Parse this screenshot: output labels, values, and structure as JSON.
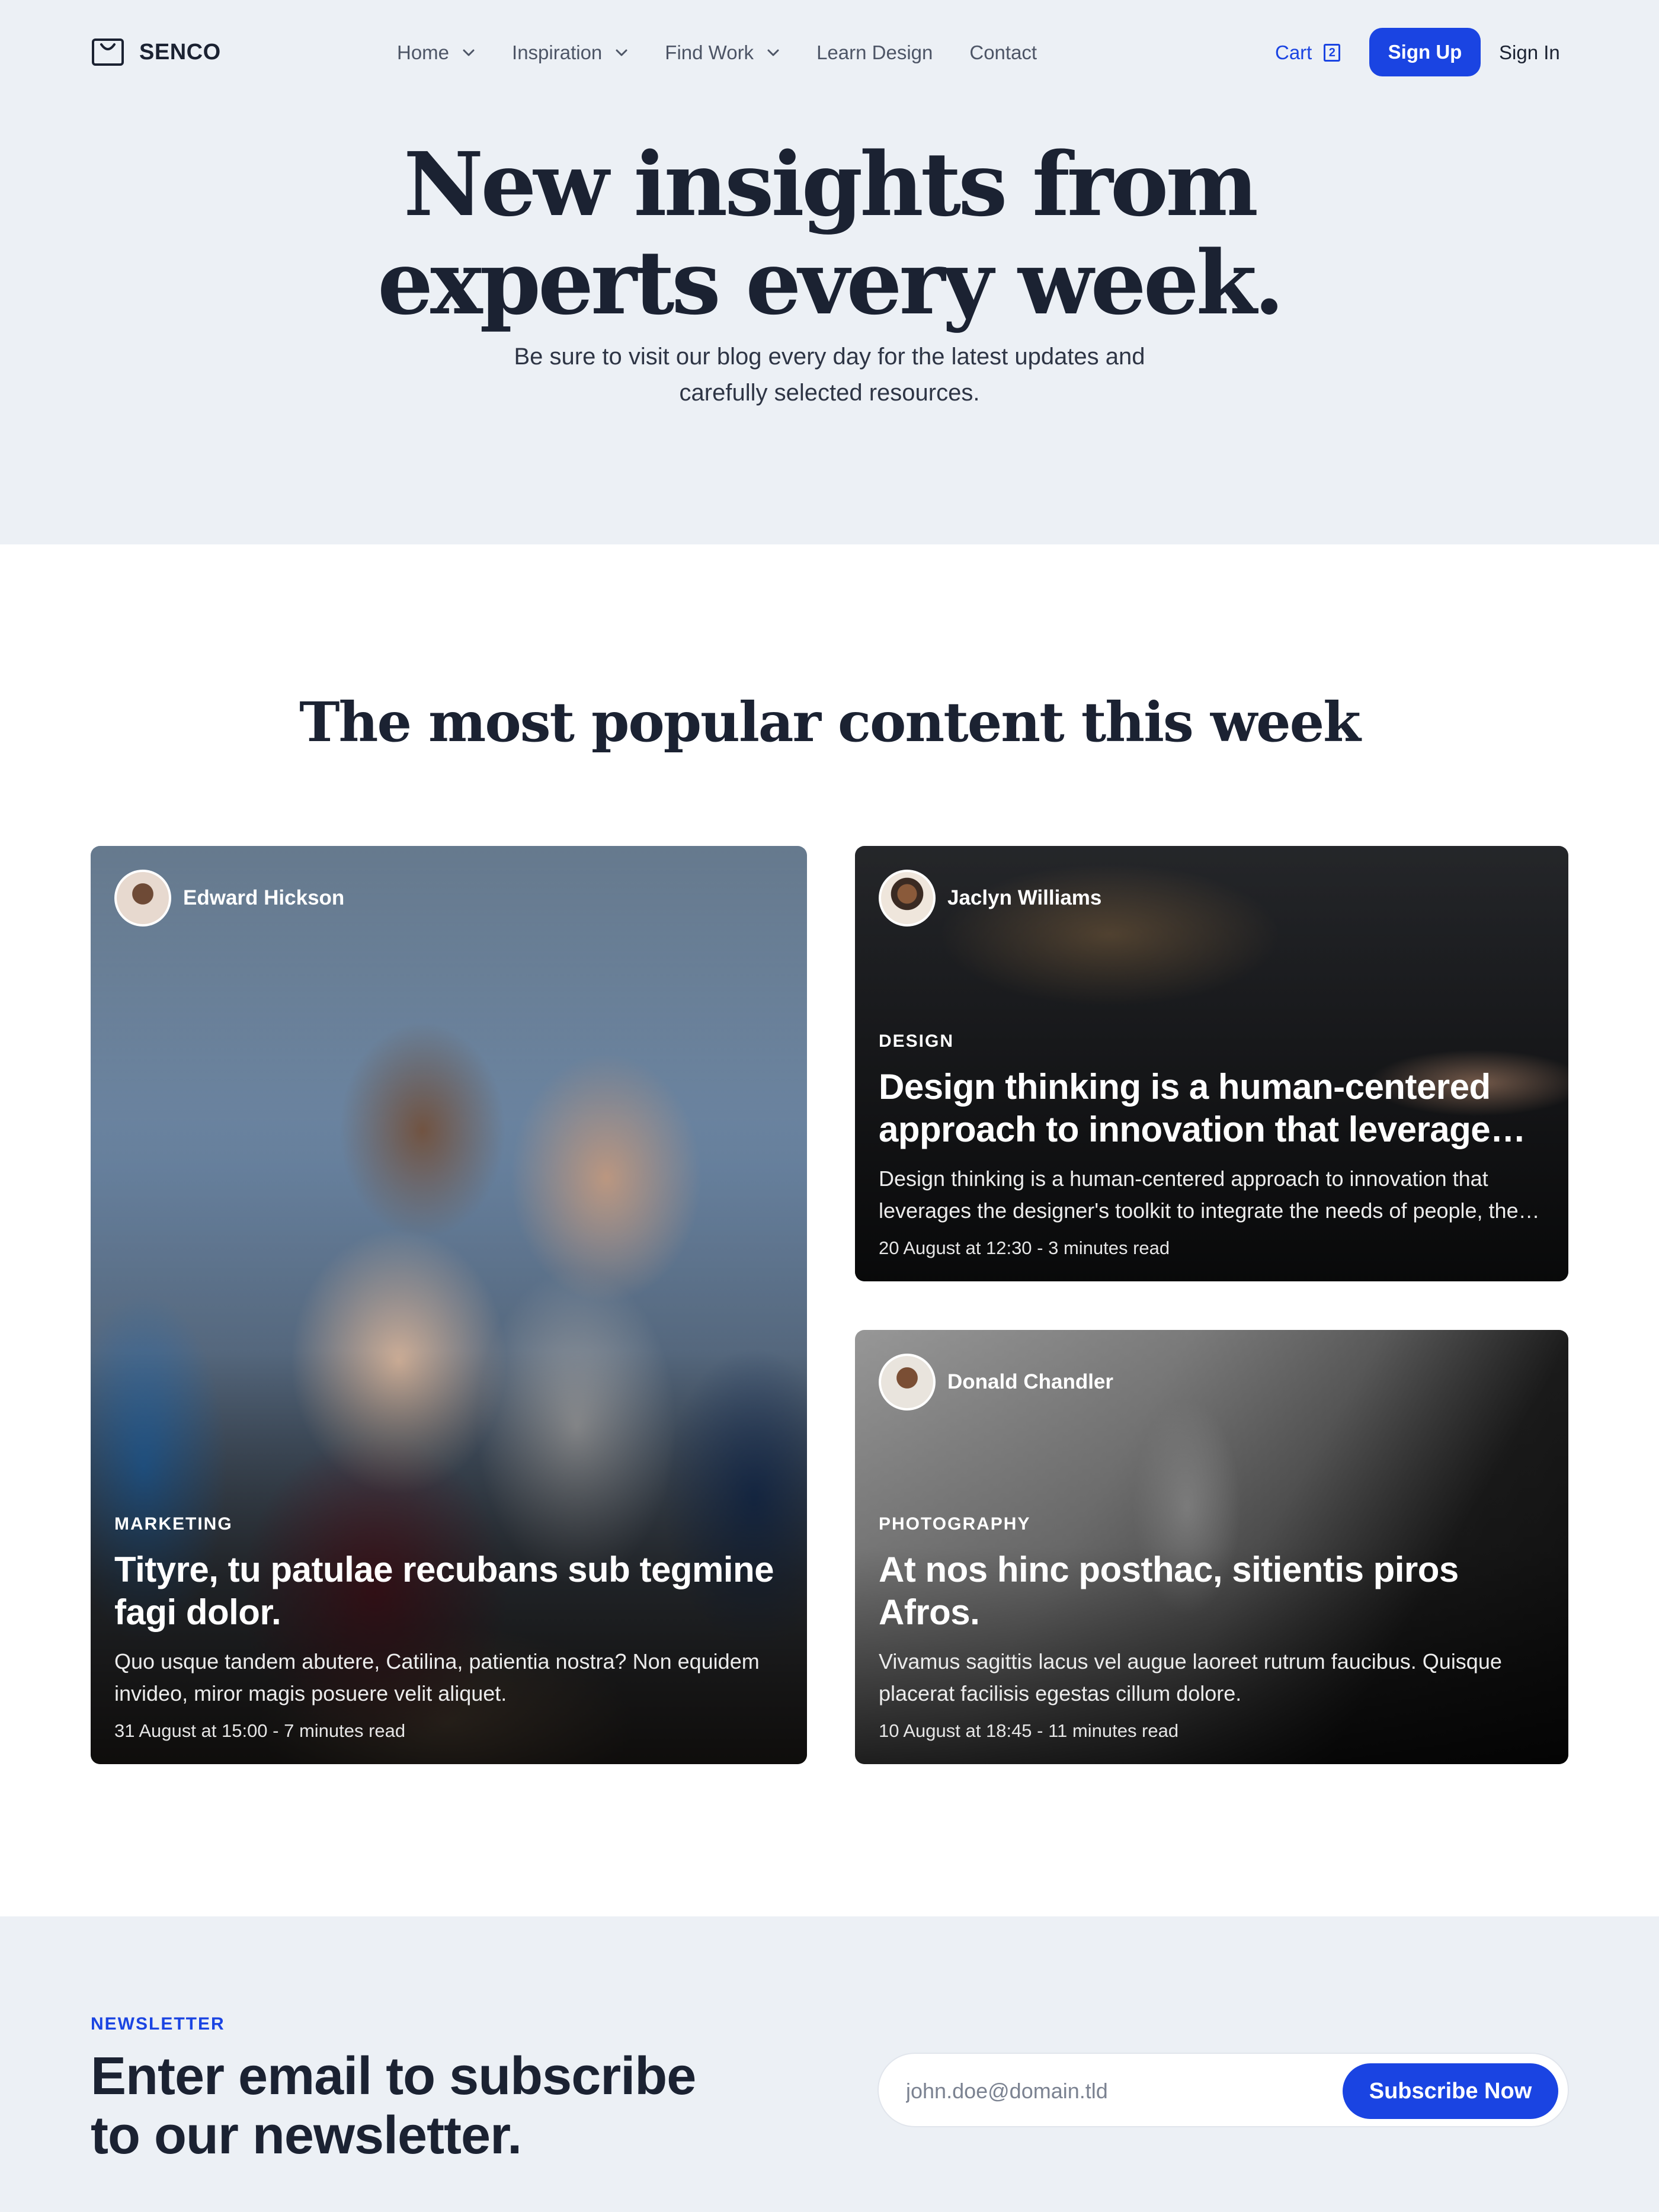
{
  "brand": {
    "name": "SENCO",
    "icon": "shopping-bag-icon"
  },
  "nav": {
    "items": [
      {
        "label": "Home",
        "has_dropdown": true
      },
      {
        "label": "Inspiration",
        "has_dropdown": true
      },
      {
        "label": "Find Work",
        "has_dropdown": true
      },
      {
        "label": "Learn Design",
        "has_dropdown": false
      },
      {
        "label": "Contact",
        "has_dropdown": false
      }
    ],
    "cart_label": "Cart",
    "cart_count": "2",
    "signup_label": "Sign Up",
    "signin_label": "Sign In"
  },
  "hero": {
    "title_line1": "New insights from",
    "title_line2": "experts every week.",
    "subtitle_line1": "Be sure to visit our blog every day for the latest updates and",
    "subtitle_line2": "carefully selected resources."
  },
  "popular": {
    "title": "The most popular content this week",
    "cards": [
      {
        "author": "Edward Hickson",
        "category": "MARKETING",
        "title": "Tityre, tu patulae recubans sub tegmine fagi dolor.",
        "excerpt": "Quo usque tandem abutere, Catilina, patientia nostra? Non equidem invideo, miror magis posuere velit aliquet.",
        "meta": "31 August at 15:00 - 7 minutes read"
      },
      {
        "author": "Jaclyn Williams",
        "category": "DESIGN",
        "title": "Design thinking is a human-centered approach to innovation that leverages the designer's toolkit",
        "excerpt": "Design thinking is a human-centered approach to innovation that leverages the designer's toolkit to integrate the needs of people, the possibilities of technology",
        "meta": "20 August at 12:30 - 3 minutes read"
      },
      {
        "author": "Donald Chandler",
        "category": "PHOTOGRAPHY",
        "title": "At nos hinc posthac, sitientis piros Afros.",
        "excerpt": "Vivamus sagittis lacus vel augue laoreet rutrum faucibus. Quisque placerat facilisis egestas cillum dolore.",
        "meta": "10 August at 18:45 - 11 minutes read"
      }
    ]
  },
  "newsletter": {
    "label": "NEWSLETTER",
    "title_line1": "Enter email to subscribe",
    "title_line2": "to our newsletter.",
    "email_placeholder": "john.doe@domain.tld",
    "button_label": "Subscribe Now"
  },
  "colors": {
    "accent": "#1a44e2",
    "hero_bg": "#ecf0f5",
    "text_dark": "#1b2232"
  }
}
